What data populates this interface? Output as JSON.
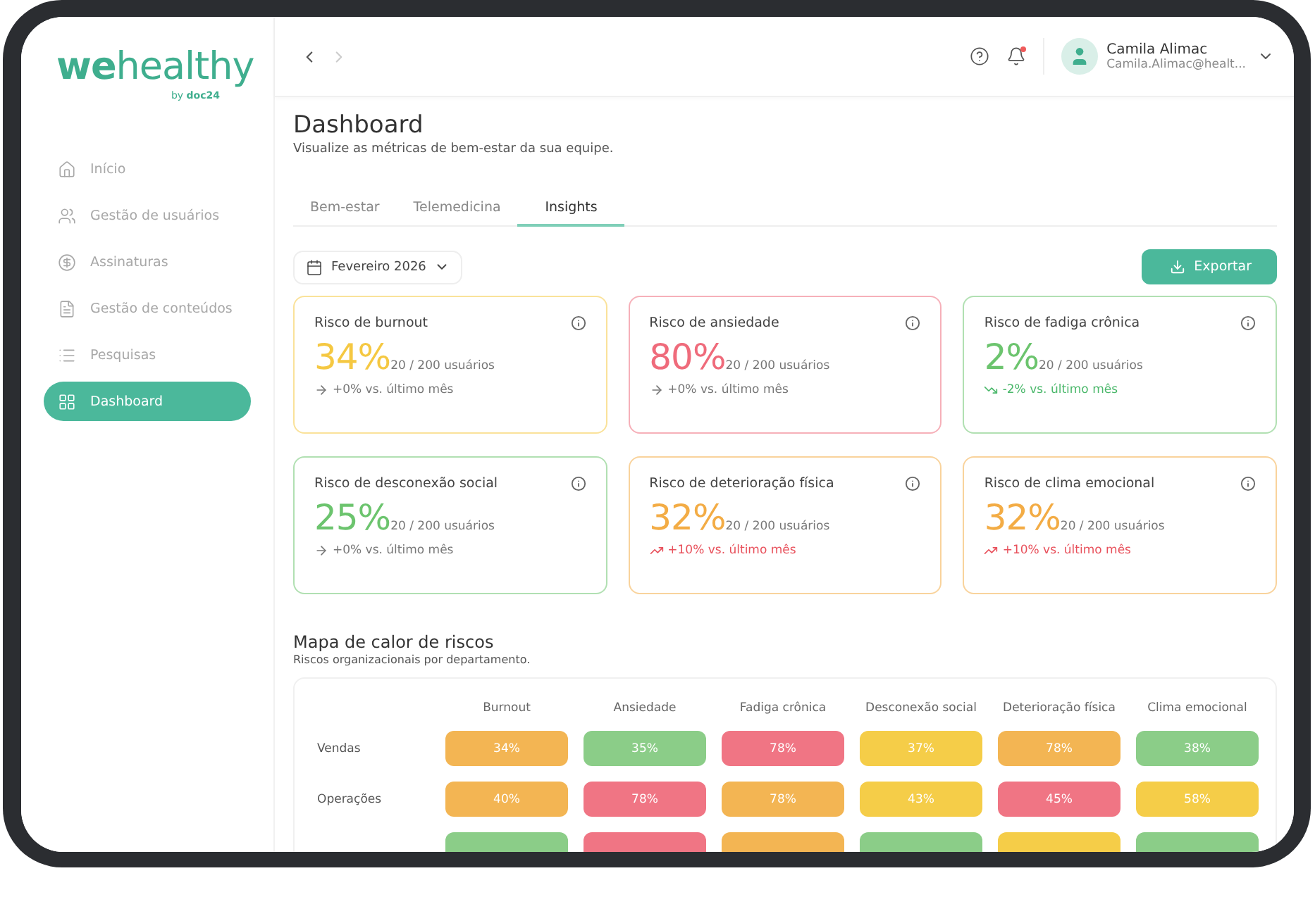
{
  "logo": {
    "name": "**we**healthy",
    "byline": "by **doc24**"
  },
  "sidebar": {
    "items": [
      {
        "label": "Início",
        "selected": false
      },
      {
        "label": "Gestão de usuários",
        "selected": false
      },
      {
        "label": "Assinaturas",
        "selected": false
      },
      {
        "label": "Gestão de conteúdos",
        "selected": false
      },
      {
        "label": "Pesquisas",
        "selected": false
      },
      {
        "label": "Dashboard",
        "selected": true
      }
    ]
  },
  "topbar": {
    "notifications_unread": true,
    "user": {
      "name": "Camila Alimac",
      "email": "Camila.Alimac@healt..."
    }
  },
  "page": {
    "title": "Dashboard",
    "subtitle": "Visualize as métricas de bem-estar da sua equipe."
  },
  "tabs": [
    {
      "label": "Bem-estar",
      "selected": false
    },
    {
      "label": "Telemedicina",
      "selected": false
    },
    {
      "label": "Insights",
      "selected": true
    }
  ],
  "period": {
    "value": "Fevereiro 2026"
  },
  "export_button": "Exportar",
  "cards": [
    {
      "title": "Risco de burnout",
      "value": "34%",
      "count": "20 / 200 usuários",
      "color": "#f5c842",
      "trend": {
        "kind": "flat",
        "text": "+0% vs. último mês"
      }
    },
    {
      "title": "Risco de ansiedade",
      "value": "80%",
      "count": "20 / 200 usuários",
      "color": "#ef6b7b",
      "trend": {
        "kind": "flat",
        "text": "+0% vs. último mês"
      }
    },
    {
      "title": "Risco de fadiga crônica",
      "value": "2%",
      "count": "20 / 200 usuários",
      "color": "#6cc46e",
      "trend": {
        "kind": "down",
        "text": "-2% vs. último mês"
      }
    },
    {
      "title": "Risco de desconexão social",
      "value": "25%",
      "count": "20 / 200 usuários",
      "color": "#6cc46e",
      "trend": {
        "kind": "flat",
        "text": "+0% vs. último mês"
      }
    },
    {
      "title": "Risco de deterioração física",
      "value": "32%",
      "count": "20 / 200 usuários",
      "color": "#f3ac45",
      "trend": {
        "kind": "up",
        "text": "+10% vs. último mês"
      }
    },
    {
      "title": "Risco de clima emocional",
      "value": "32%",
      "count": "20 / 200 usuários",
      "color": "#f3ac45",
      "trend": {
        "kind": "up",
        "text": "+10% vs. último mês"
      }
    }
  ],
  "heatmap": {
    "title": "Mapa de calor de riscos",
    "subtitle": "Riscos organizacionais por departamento.",
    "columns": [
      "Burnout",
      "Ansiedade",
      "Fadiga crônica",
      "Desconexão social",
      "Deterioração física",
      "Clima emocional"
    ],
    "rows": [
      {
        "label": "Vendas",
        "cells": [
          {
            "value": "34%",
            "color": "#f3b553"
          },
          {
            "value": "35%",
            "color": "#8bcd88"
          },
          {
            "value": "78%",
            "color": "#f07584"
          },
          {
            "value": "37%",
            "color": "#f5cd48"
          },
          {
            "value": "78%",
            "color": "#f3b553"
          },
          {
            "value": "38%",
            "color": "#8bcd88"
          }
        ]
      },
      {
        "label": "Operações",
        "cells": [
          {
            "value": "40%",
            "color": "#f3b553"
          },
          {
            "value": "78%",
            "color": "#f07584"
          },
          {
            "value": "78%",
            "color": "#f3b553"
          },
          {
            "value": "43%",
            "color": "#f5cd48"
          },
          {
            "value": "45%",
            "color": "#f07584"
          },
          {
            "value": "58%",
            "color": "#f5cd48"
          }
        ]
      },
      {
        "cells": [
          {
            "color": "#8bcd88"
          },
          {
            "color": "#f07584"
          },
          {
            "color": "#f3b553"
          },
          {
            "color": "#8bcd88"
          },
          {
            "color": "#f5cd48"
          },
          {
            "color": "#8bcd88"
          }
        ]
      }
    ]
  }
}
